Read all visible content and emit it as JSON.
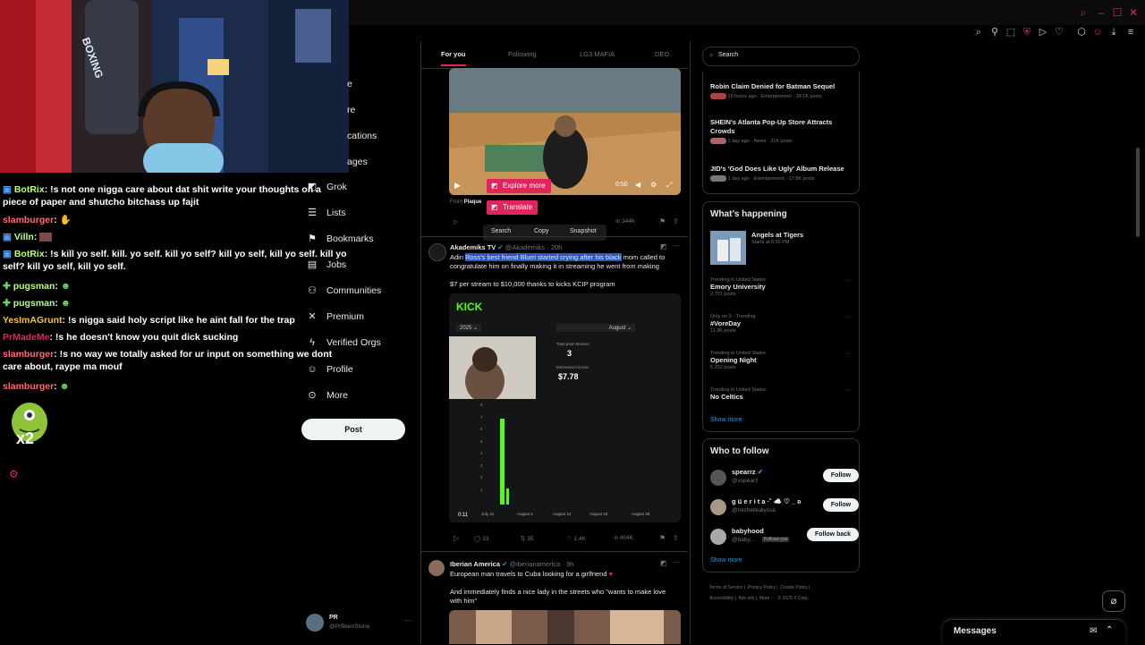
{
  "colors": {
    "accent": "#e0245e",
    "link": "#1d9bf0",
    "bg": "#000000",
    "border": "#2f3336",
    "verified": "#1d9bf0",
    "follow_bg": "#eff3f4"
  },
  "webcam": {
    "sign_text": "BOXING"
  },
  "chat": {
    "lines": [
      {
        "user": "BotRix",
        "color": "#b6ff7a",
        "text": ": !s not one nigga care about dat shit write your thoughts on a piece of paper and shutcho bitchass up fajit"
      },
      {
        "user": "slamburger",
        "color": "#ff6b6b",
        "text": ":"
      },
      {
        "user": "Villn",
        "color": "#b6ff7a",
        "text": ":"
      },
      {
        "user": "BotRix",
        "color": "#b6ff7a",
        "text": ": !s kill yo self. kill. yo self. kill yo self? kill yo self, kill yo self. kill yo self? kill yo self, kill yo self."
      },
      {
        "user": "pugsman",
        "color": "#b6ff7a",
        "text": ":"
      },
      {
        "user": "pugsman",
        "color": "#b6ff7a",
        "text": ":"
      },
      {
        "user": "YesImAGrunt",
        "color": "#f5c24b",
        "text": ": !s nigga said holy script like he aint fall for the trap"
      },
      {
        "user": "PrMadeMe",
        "color": "#e0245e",
        "text": ": !s he doesn't know you quit dick sucking"
      },
      {
        "user": "slamburger",
        "color": "#ff6b6b",
        "text": ": !s no way we totally asked for ur input on something we dont care about, raype ma mouf"
      },
      {
        "user": "slamburger",
        "color": "#ff6b6b",
        "text": ":"
      }
    ],
    "emote_label": "x2"
  },
  "nav": {
    "partial": [
      {
        "text": "e"
      },
      {
        "text": "re"
      },
      {
        "text": "cations"
      },
      {
        "text": "ages"
      }
    ],
    "items": [
      {
        "label": "Grok",
        "icon": "grok-icon"
      },
      {
        "label": "Lists",
        "icon": "lists-icon"
      },
      {
        "label": "Bookmarks",
        "icon": "bookmark-icon"
      },
      {
        "label": "Jobs",
        "icon": "jobs-icon"
      },
      {
        "label": "Communities",
        "icon": "communities-icon"
      },
      {
        "label": "Premium",
        "icon": "x-logo-icon"
      },
      {
        "label": "Verified Orgs",
        "icon": "lightning-icon"
      },
      {
        "label": "Profile",
        "icon": "person-icon"
      },
      {
        "label": "More",
        "icon": "more-circle-icon"
      }
    ],
    "post_label": "Post",
    "account": {
      "name": "PR",
      "handle": "@PrBeenStone"
    }
  },
  "feed": {
    "tabs": [
      "For you",
      "Following",
      "LG3 MAFIA",
      "DEO"
    ],
    "video": {
      "time": "0:50",
      "from_prefix": "From",
      "from_name": "Plaque"
    },
    "context_menu": {
      "explore_more": "Explore more",
      "translate": "Translate",
      "search": "Search",
      "copy": "Copy",
      "snapshot": "Snapshot"
    },
    "tweet1": {
      "stats_views": "344K"
    },
    "tweet2": {
      "name": "Akademiks TV",
      "handle": "@Akademiks",
      "time": "· 20h",
      "text_pre": "Adin ",
      "text_highlight": "Ross's best friend Blurri started crying after his black",
      "text_post": " mom called to congratulate him on finally making it in streaming he went from making",
      "text_line2": "$7 per stream to $10,000 thanks to kicks KCIP program",
      "kick_logo": "KICK",
      "dropdown_year": "2025",
      "dropdown_month": "August",
      "stat1_label": "Total paid streams",
      "stat1_value": "3",
      "stat2_label": "Estimated income",
      "stat2_value": "$7.78",
      "x_ticks": [
        "July 31",
        "August 6",
        "August 12",
        "August 18",
        "August 25"
      ],
      "y_ticks": [
        "8",
        "7",
        "6",
        "5",
        "4",
        "3",
        "2",
        "1"
      ],
      "video_time": "0:11",
      "replies": "33",
      "reposts": "35",
      "likes": "1.4K",
      "views": "404K"
    },
    "tweet3": {
      "name": "Iberian America",
      "handle": "@iberianamerica",
      "time": "· 9h",
      "text1": "European man travels to Cuba looking for a girlfriend",
      "text2": "And immediately finds a nice lady in the streets who \"wants to make love with him\""
    }
  },
  "right": {
    "search_placeholder": "Search",
    "news": [
      {
        "title": "Robin Claim Denied for Batman Sequel",
        "meta": "16 hours ago · Entertainment · 38.1K posts"
      },
      {
        "title": "SHEIN's Atlanta Pop-Up Store Attracts Crowds",
        "meta": "1 day ago · News · 21K posts"
      },
      {
        "title": "JID's 'God Does Like Ugly' Album Release",
        "meta": "1 day ago · Entertainment · 17.8K posts"
      }
    ],
    "happening_title": "What’s happening",
    "event": {
      "title": "Angels at Tigers",
      "meta": "Starts at 6:10 PM"
    },
    "trends": [
      {
        "meta": "Trending in United States",
        "title": "Emory University",
        "count": "2,701 posts"
      },
      {
        "meta": "Only on X · Trending",
        "title": "#VoreDay",
        "count": "11.9K posts"
      },
      {
        "meta": "Trending in United States",
        "title": "Opening Night",
        "count": "5,252 posts"
      },
      {
        "meta": "Trending in United States",
        "title": "No Celtics",
        "count": ""
      }
    ],
    "show_more": "Show more",
    "who_title": "Who to follow",
    "follow": [
      {
        "name": "spearrz",
        "handle": "@xspearz",
        "button": "Follow",
        "verified": true
      },
      {
        "name": "g ü e r i t a ·˚ ☁️ ♡ _ ʚ",
        "handle": "@michellealyssa",
        "button": "Follow",
        "verified": false
      },
      {
        "name": "babyhood",
        "handle": "@baby...",
        "badge": "Follows you",
        "button": "Follow back",
        "verified": false
      }
    ],
    "show_more2": "Show more",
    "footer": [
      "Terms of Service",
      "Privacy Policy",
      "Cookie Policy",
      "Accessibility",
      "Ads info",
      "More ···",
      "© 2025 X Corp."
    ]
  },
  "messages": {
    "label": "Messages"
  }
}
